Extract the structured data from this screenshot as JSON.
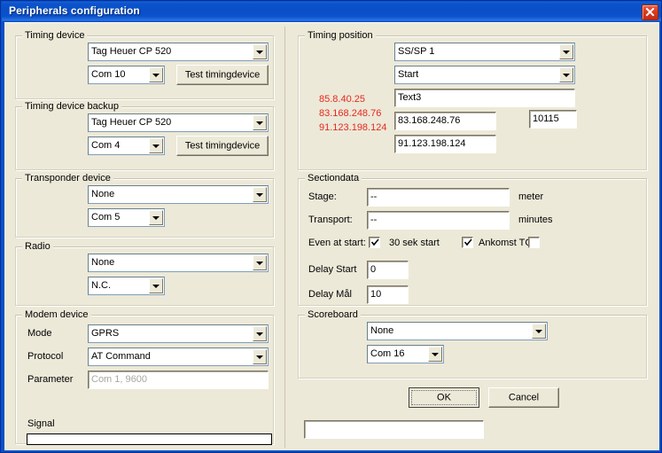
{
  "window": {
    "title": "Peripherals configuration",
    "close_icon": "close-x-icon",
    "title_bar_color": "#0a50c8",
    "body_color": "#ece9d8"
  },
  "timing_device": {
    "legend": "Timing device",
    "device": "Tag Heuer CP 520",
    "port": "Com 10",
    "test_button": "Test timingdevice"
  },
  "timing_device_backup": {
    "legend": "Timing device backup",
    "device": "Tag Heuer CP 520",
    "port": "Com 4",
    "test_button": "Test timingdevice"
  },
  "transponder_device": {
    "legend": "Transponder device",
    "device": "None",
    "port": "Com 5"
  },
  "radio": {
    "legend": "Radio",
    "device": "None",
    "port": "N.C."
  },
  "modem_device": {
    "legend": "Modem device",
    "mode_label": "Mode",
    "mode": "GPRS",
    "protocol_label": "Protocol",
    "protocol": "AT Command",
    "parameter_label": "Parameter",
    "parameter_placeholder": "Com 1, 9600",
    "signal_label": "Signal",
    "signal_percent": 0
  },
  "timing_position": {
    "legend": "Timing position",
    "position": "SS/SP 1",
    "type": "Start",
    "name": "Text3",
    "ip_primary": "83.168.248.76",
    "port": "10115",
    "ip_secondary": "91.123.198.124",
    "detected_addresses": [
      "85.8.40.25",
      "83.168.248.76",
      "91.123.198.124"
    ],
    "detected_color": "#e8281e"
  },
  "sectiondata": {
    "legend": "Sectiondata",
    "stage_label": "Stage:",
    "stage_value": "--",
    "stage_unit": "meter",
    "transport_label": "Transport:",
    "transport_value": "--",
    "transport_unit": "minutes",
    "even_at_start_label": "Even at start:",
    "even_at_start_checked": true,
    "sek30_start_label": "30 sek start",
    "sek30_start_checked": true,
    "ankomst_tc_label": "Ankomst TC",
    "ankomst_tc_checked": false,
    "delay_start_label": "Delay Start",
    "delay_start_value": "0",
    "delay_mal_label": "Delay Mål",
    "delay_mal_value": "10"
  },
  "scoreboard": {
    "legend": "Scoreboard",
    "device": "None",
    "port": "Com 16"
  },
  "actions": {
    "ok_label": "OK",
    "cancel_label": "Cancel",
    "status_value": ""
  }
}
